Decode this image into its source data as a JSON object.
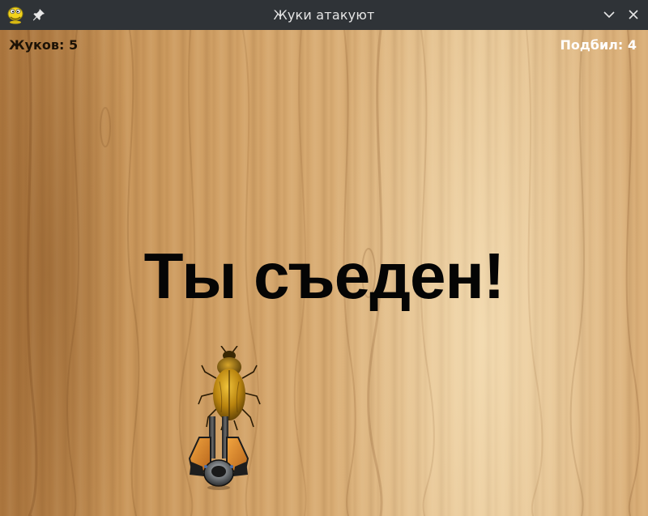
{
  "window": {
    "title": "Жуки атакуют",
    "icons": {
      "app": "pygame-snake-icon",
      "pin": "pin-icon",
      "minimize": "chevron-down-icon",
      "close": "close-icon"
    }
  },
  "hud": {
    "bugs_label": "Жуков: 5",
    "hits_label": "Подбил: 4"
  },
  "message": "Ты съеден!",
  "sprites": {
    "enemy": "beetle-sprite",
    "player": "cannon-sprite"
  },
  "colors": {
    "titlebar": "#2f3337",
    "hud_left_text": "#1c1206",
    "hud_right_text": "#ffffff",
    "message_text": "#050505"
  }
}
